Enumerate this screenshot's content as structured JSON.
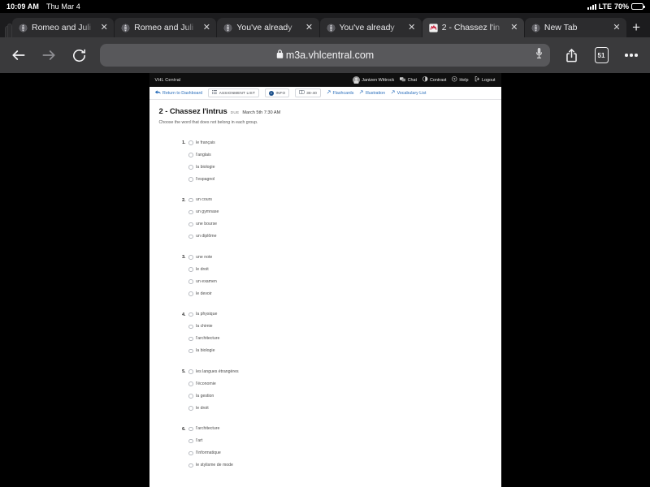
{
  "statusbar": {
    "time": "10:09 AM",
    "date": "Thu Mar 4",
    "carrier": "LTE",
    "battery": "70%"
  },
  "tabs": [
    {
      "label": "Romeo and Juli",
      "favicon": "globe-icon",
      "active": false
    },
    {
      "label": "Romeo and Juli",
      "favicon": "globe-icon",
      "active": false
    },
    {
      "label": "You've already",
      "favicon": "globe-icon",
      "active": false
    },
    {
      "label": "You've already",
      "favicon": "globe-icon",
      "active": false
    },
    {
      "label": "2 - Chassez l'in",
      "favicon": "vhl-icon",
      "active": true
    },
    {
      "label": "New Tab",
      "favicon": "globe-icon",
      "active": false
    }
  ],
  "toolbar": {
    "back": "back-arrow",
    "forward": "forward-arrow",
    "reload": "reload-icon",
    "url": "m3a.vhlcentral.com",
    "lock": "lock-icon",
    "mic": "microphone-icon",
    "share": "share-icon",
    "tab_count": "51",
    "more": "more-options"
  },
  "page": {
    "brand": "VHL Central",
    "topbar_items": [
      {
        "icon": "user-avatar",
        "label": "Jantzen Wittrock"
      },
      {
        "icon": "chat-icon",
        "label": "Chat"
      },
      {
        "icon": "contrast-icon",
        "label": "Contrast"
      },
      {
        "icon": "help-icon",
        "label": "Help"
      },
      {
        "icon": "logout-icon",
        "label": "Logout"
      }
    ],
    "nav_items": [
      {
        "label": "Return to Dashboard",
        "icon": "back-arrow-icon",
        "style": "link"
      },
      {
        "label": "ASSIGNMENT LIST",
        "icon": "list-icon",
        "style": "boxed"
      },
      {
        "label": "INFO",
        "icon": "info-badge",
        "style": "boxed"
      },
      {
        "label": "38-40",
        "icon": "book-icon",
        "style": "boxed"
      },
      {
        "label": "Flashcards",
        "icon": "arrow-icon",
        "style": "link"
      },
      {
        "label": "Illustration",
        "icon": "arrow-icon",
        "style": "link"
      },
      {
        "label": "Vocabulary List",
        "icon": "arrow-icon",
        "style": "link"
      }
    ],
    "activity": {
      "title": "2 - Chassez l'intrus",
      "due_label": "DUE",
      "due_date": "March 5th 7:30 AM",
      "instructions": "Choose the word that does not belong in each group."
    },
    "questions": [
      {
        "number": "1.",
        "options": [
          "le français",
          "l'anglais",
          "la biologie",
          "l'espagnol"
        ]
      },
      {
        "number": "2.",
        "options": [
          "un cours",
          "un gymnase",
          "une bourse",
          "un diplôme"
        ]
      },
      {
        "number": "3.",
        "options": [
          "une note",
          "le droit",
          "un examen",
          "le devoir"
        ]
      },
      {
        "number": "4.",
        "options": [
          "la physique",
          "la chimie",
          "l'architecture",
          "la biologie"
        ]
      },
      {
        "number": "5.",
        "options": [
          "les langues étrangères",
          "l'économie",
          "la gestion",
          "le droit"
        ]
      },
      {
        "number": "6.",
        "options": [
          "l'architecture",
          "l'art",
          "l'informatique",
          "le stylisme de mode"
        ]
      }
    ]
  },
  "colors": {
    "chrome_bg": "#1c1c1e",
    "toolbar_bg": "#3a3a3c",
    "vhl_black": "#0f0f0f",
    "link_blue": "#2a6ebb",
    "page_surround": "#bfbfc4"
  }
}
